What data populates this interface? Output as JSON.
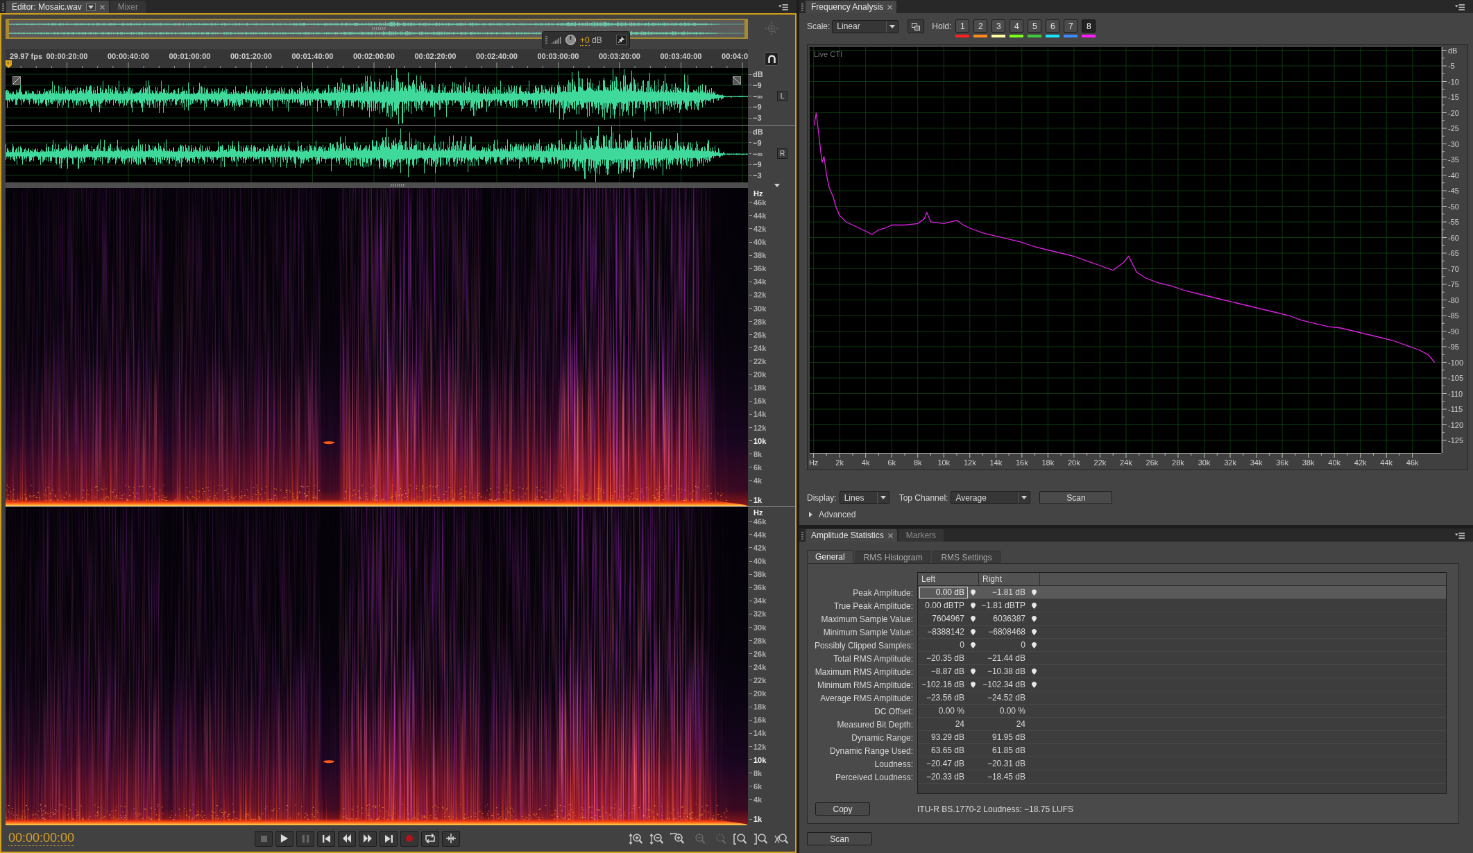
{
  "editor": {
    "tabs": [
      {
        "label": "Editor: Mosaic.wav",
        "selected": true,
        "kind": "menu"
      },
      {
        "label": "Mixer",
        "selected": false,
        "kind": "plain"
      }
    ],
    "overview": {
      "zoom_disabled": true
    },
    "hud": {
      "value": "+0",
      "unit": "dB"
    },
    "timeline": {
      "frame_rate": "29.97 fps",
      "ticks": [
        "00:00:20:00",
        "00:00:40:00",
        "00:01:00:00",
        "00:01:20:00",
        "00:01:40:00",
        "00:02:00:00",
        "00:02:20:00",
        "00:02:40:00",
        "00:03:00:00",
        "00:03:20:00",
        "00:03:40:00",
        "00:04:0"
      ]
    },
    "channels": [
      {
        "label": "L",
        "scale": [
          "dB",
          "−9",
          "−∞",
          "−9",
          "−3"
        ]
      },
      {
        "label": "R",
        "scale": [
          "dB",
          "−9",
          "−∞",
          "−9",
          "−3"
        ]
      }
    ],
    "spectral_channels": [
      {
        "scale": [
          {
            "label": "Hz",
            "major": true
          },
          {
            "label": "46k",
            "major": false
          },
          {
            "label": "44k",
            "major": false
          },
          {
            "label": "42k",
            "major": false
          },
          {
            "label": "40k",
            "major": false
          },
          {
            "label": "38k",
            "major": false
          },
          {
            "label": "36k",
            "major": false
          },
          {
            "label": "34k",
            "major": false
          },
          {
            "label": "32k",
            "major": false
          },
          {
            "label": "30k",
            "major": false
          },
          {
            "label": "28k",
            "major": false
          },
          {
            "label": "26k",
            "major": false
          },
          {
            "label": "24k",
            "major": false
          },
          {
            "label": "22k",
            "major": false
          },
          {
            "label": "20k",
            "major": false
          },
          {
            "label": "18k",
            "major": false
          },
          {
            "label": "16k",
            "major": false
          },
          {
            "label": "14k",
            "major": false
          },
          {
            "label": "12k",
            "major": false
          },
          {
            "label": "10k",
            "major": true
          },
          {
            "label": "8k",
            "major": false
          },
          {
            "label": "6k",
            "major": false
          },
          {
            "label": "4k",
            "major": false
          },
          {
            "label": "1k",
            "major": true
          }
        ]
      },
      {
        "scale": [
          {
            "label": "Hz",
            "major": true
          },
          {
            "label": "46k",
            "major": false
          },
          {
            "label": "44k",
            "major": false
          },
          {
            "label": "42k",
            "major": false
          },
          {
            "label": "40k",
            "major": false
          },
          {
            "label": "38k",
            "major": false
          },
          {
            "label": "36k",
            "major": false
          },
          {
            "label": "34k",
            "major": false
          },
          {
            "label": "32k",
            "major": false
          },
          {
            "label": "30k",
            "major": false
          },
          {
            "label": "28k",
            "major": false
          },
          {
            "label": "26k",
            "major": false
          },
          {
            "label": "24k",
            "major": false
          },
          {
            "label": "22k",
            "major": false
          },
          {
            "label": "20k",
            "major": false
          },
          {
            "label": "18k",
            "major": false
          },
          {
            "label": "16k",
            "major": false
          },
          {
            "label": "14k",
            "major": false
          },
          {
            "label": "12k",
            "major": false
          },
          {
            "label": "10k",
            "major": true
          },
          {
            "label": "8k",
            "major": false
          },
          {
            "label": "6k",
            "major": false
          },
          {
            "label": "4k",
            "major": false
          },
          {
            "label": "1k",
            "major": true
          }
        ]
      }
    ],
    "transport": {
      "time": "00:00:00:00",
      "buttons": [
        {
          "disabled": true
        },
        {
          "disabled": false
        },
        {
          "disabled": true
        },
        {
          "disabled": false
        },
        {
          "disabled": false
        },
        {
          "disabled": false
        },
        {
          "disabled": false
        },
        {
          "disabled": false
        },
        {
          "disabled": false
        },
        {
          "disabled": false
        }
      ],
      "zoom_buttons": [
        {
          "disabled": false
        },
        {
          "disabled": false
        },
        {
          "disabled": false
        },
        {
          "disabled": true
        },
        {
          "disabled": true
        },
        {
          "disabled": false
        },
        {
          "disabled": false
        },
        {
          "disabled": false
        }
      ]
    }
  },
  "frequency_analysis": {
    "tabs": [
      {
        "label": "Frequency Analysis",
        "selected": true
      }
    ],
    "scale": {
      "label": "Scale:",
      "value": "Linear"
    },
    "hold": {
      "label": "Hold:",
      "buttons": [
        {
          "label": "1",
          "color": "#ff2020",
          "selected": false
        },
        {
          "label": "2",
          "color": "#ff8c1a",
          "selected": false
        },
        {
          "label": "3",
          "color": "#ffffa6",
          "selected": false
        },
        {
          "label": "4",
          "color": "#7cff1a",
          "selected": false
        },
        {
          "label": "5",
          "color": "#3ccc3c",
          "selected": false
        },
        {
          "label": "6",
          "color": "#1ae5ff",
          "selected": false
        },
        {
          "label": "7",
          "color": "#3a8cff",
          "selected": false
        },
        {
          "label": "8",
          "color": "#ff1aff",
          "selected": true
        }
      ]
    },
    "chart_data": {
      "type": "line",
      "grid": true,
      "x": [
        0.05,
        0.2,
        0.4,
        0.65,
        0.8,
        1,
        1.2,
        1.5,
        1.7,
        2,
        2.5,
        3,
        3.5,
        4,
        4.5,
        5,
        5.5,
        6,
        7,
        8,
        8.5,
        8.7,
        9,
        10,
        11,
        11.5,
        12,
        13,
        14,
        15,
        16,
        17,
        18,
        19,
        20,
        21,
        22,
        23,
        23.8,
        24.2,
        24.8,
        25.5,
        26.5,
        27.5,
        28.5,
        29.5,
        30.5,
        31.5,
        32.5,
        33.5,
        34.5,
        35.5,
        36.5,
        37.5,
        38.5,
        39.5,
        40.5,
        41.5,
        42.5,
        43.5,
        44.5,
        45.5,
        46.5,
        47.2,
        47.7
      ],
      "series": [
        {
          "name": "Live CTI",
          "color": "#e020e6",
          "values": [
            -24,
            -20,
            -27,
            -36,
            -34,
            -40,
            -44,
            -47,
            -50,
            -53,
            -55,
            -56,
            -57,
            -58,
            -59,
            -57.5,
            -57,
            -56,
            -56,
            -55.5,
            -54,
            -52,
            -55,
            -55.5,
            -54.5,
            -56,
            -57,
            -58.5,
            -59.5,
            -60.5,
            -61.5,
            -63,
            -64,
            -65,
            -66,
            -67.5,
            -69,
            -70.5,
            -68,
            -66,
            -71,
            -73,
            -74.5,
            -75.5,
            -77,
            -78,
            -79,
            -80,
            -81,
            -82,
            -83,
            -84,
            -85,
            -86.5,
            -87.5,
            -88.5,
            -89,
            -90,
            -91,
            -92,
            -93,
            -94.5,
            -96,
            -97.5,
            -100
          ]
        }
      ],
      "xlim": [
        -0.3,
        48.2
      ],
      "ylim": [
        -129,
        1
      ],
      "xticks": [
        {
          "value": 0,
          "label": "Hz"
        },
        {
          "value": 2,
          "label": "2k"
        },
        {
          "value": 4,
          "label": "4k"
        },
        {
          "value": 6,
          "label": "6k"
        },
        {
          "value": 8,
          "label": "8k"
        },
        {
          "value": 10,
          "label": "10k"
        },
        {
          "value": 12,
          "label": "12k"
        },
        {
          "value": 14,
          "label": "14k"
        },
        {
          "value": 16,
          "label": "16k"
        },
        {
          "value": 18,
          "label": "18k"
        },
        {
          "value": 20,
          "label": "20k"
        },
        {
          "value": 22,
          "label": "22k"
        },
        {
          "value": 24,
          "label": "24k"
        },
        {
          "value": 26,
          "label": "26k"
        },
        {
          "value": 28,
          "label": "28k"
        },
        {
          "value": 30,
          "label": "30k"
        },
        {
          "value": 32,
          "label": "32k"
        },
        {
          "value": 34,
          "label": "34k"
        },
        {
          "value": 36,
          "label": "36k"
        },
        {
          "value": 38,
          "label": "38k"
        },
        {
          "value": 40,
          "label": "40k"
        },
        {
          "value": 42,
          "label": "42k"
        },
        {
          "value": 44,
          "label": "44k"
        },
        {
          "value": 46,
          "label": "46k"
        }
      ],
      "yticks": [
        {
          "value": 0,
          "label": "dB"
        },
        -5,
        -10,
        -15,
        -20,
        -25,
        -30,
        -35,
        -40,
        -45,
        -50,
        -55,
        -60,
        -65,
        -70,
        -75,
        -80,
        -85,
        -90,
        -95,
        -100,
        -105,
        -110,
        -115,
        -120,
        -125
      ]
    },
    "display": {
      "label": "Display:",
      "value": "Lines"
    },
    "top_channel": {
      "label": "Top Channel:",
      "value": "Average"
    },
    "scan": "Scan",
    "advanced": {
      "label": "Advanced",
      "expanded": false
    }
  },
  "amplitude_statistics": {
    "tabs": [
      {
        "label": "Amplitude Statistics",
        "selected": true
      },
      {
        "label": "Markers",
        "selected": false
      }
    ],
    "subtabs": [
      {
        "label": "General",
        "selected": true
      },
      {
        "label": "RMS Histogram",
        "selected": false
      },
      {
        "label": "RMS Settings",
        "selected": false
      }
    ],
    "table": {
      "columns": [
        "Left",
        "Right"
      ],
      "rows": [
        {
          "label": "Peak Amplitude:",
          "selected": true,
          "cells": [
            {
              "value": "0.00 dB",
              "marker": true,
              "focused": true
            },
            {
              "value": "−1.81 dB",
              "marker": true,
              "focused": false
            }
          ]
        },
        {
          "label": "True Peak Amplitude:",
          "selected": false,
          "cells": [
            {
              "value": "0.00 dBTP",
              "marker": true,
              "focused": false
            },
            {
              "value": "−1.81 dBTP",
              "marker": true,
              "focused": false
            }
          ]
        },
        {
          "label": "Maximum Sample Value:",
          "selected": false,
          "cells": [
            {
              "value": "7604967",
              "marker": true,
              "focused": false
            },
            {
              "value": "6036387",
              "marker": true,
              "focused": false
            }
          ]
        },
        {
          "label": "Minimum Sample Value:",
          "selected": false,
          "cells": [
            {
              "value": "−8388142",
              "marker": true,
              "focused": false
            },
            {
              "value": "−6808468",
              "marker": true,
              "focused": false
            }
          ]
        },
        {
          "label": "Possibly Clipped Samples:",
          "selected": false,
          "cells": [
            {
              "value": "0",
              "marker": true,
              "focused": false
            },
            {
              "value": "0",
              "marker": true,
              "focused": false
            }
          ]
        },
        {
          "label": "Total RMS Amplitude:",
          "selected": false,
          "cells": [
            {
              "value": "−20.35 dB",
              "marker": false,
              "focused": false
            },
            {
              "value": "−21.44 dB",
              "marker": false,
              "focused": false
            }
          ]
        },
        {
          "label": "Maximum RMS Amplitude:",
          "selected": false,
          "cells": [
            {
              "value": "−8.87 dB",
              "marker": true,
              "focused": false
            },
            {
              "value": "−10.38 dB",
              "marker": true,
              "focused": false
            }
          ]
        },
        {
          "label": "Minimum RMS Amplitude:",
          "selected": false,
          "cells": [
            {
              "value": "−102.16 dB",
              "marker": true,
              "focused": false
            },
            {
              "value": "−102.34 dB",
              "marker": true,
              "focused": false
            }
          ]
        },
        {
          "label": "Average RMS Amplitude:",
          "selected": false,
          "cells": [
            {
              "value": "−23.56 dB",
              "marker": false,
              "focused": false
            },
            {
              "value": "−24.52 dB",
              "marker": false,
              "focused": false
            }
          ]
        },
        {
          "label": "DC Offset:",
          "selected": false,
          "cells": [
            {
              "value": "0.00 %",
              "marker": false,
              "focused": false
            },
            {
              "value": "0.00 %",
              "marker": false,
              "focused": false
            }
          ]
        },
        {
          "label": "Measured Bit Depth:",
          "selected": false,
          "cells": [
            {
              "value": "24",
              "marker": false,
              "focused": false
            },
            {
              "value": "24",
              "marker": false,
              "focused": false
            }
          ]
        },
        {
          "label": "Dynamic Range:",
          "selected": false,
          "cells": [
            {
              "value": "93.29 dB",
              "marker": false,
              "focused": false
            },
            {
              "value": "91.95 dB",
              "marker": false,
              "focused": false
            }
          ]
        },
        {
          "label": "Dynamic Range Used:",
          "selected": false,
          "cells": [
            {
              "value": "63.65 dB",
              "marker": false,
              "focused": false
            },
            {
              "value": "61.85 dB",
              "marker": false,
              "focused": false
            }
          ]
        },
        {
          "label": "Loudness:",
          "selected": false,
          "cells": [
            {
              "value": "−20.47 dB",
              "marker": false,
              "focused": false
            },
            {
              "value": "−20.31 dB",
              "marker": false,
              "focused": false
            }
          ]
        },
        {
          "label": "Perceived Loudness:",
          "selected": false,
          "cells": [
            {
              "value": "−20.33 dB",
              "marker": false,
              "focused": false
            },
            {
              "value": "−18.45 dB",
              "marker": false,
              "focused": false
            }
          ]
        }
      ]
    },
    "copy": "Copy",
    "loudness": "ITU-R BS.1770-2 Loudness: −18.75 LUFS",
    "scan": "Scan"
  }
}
